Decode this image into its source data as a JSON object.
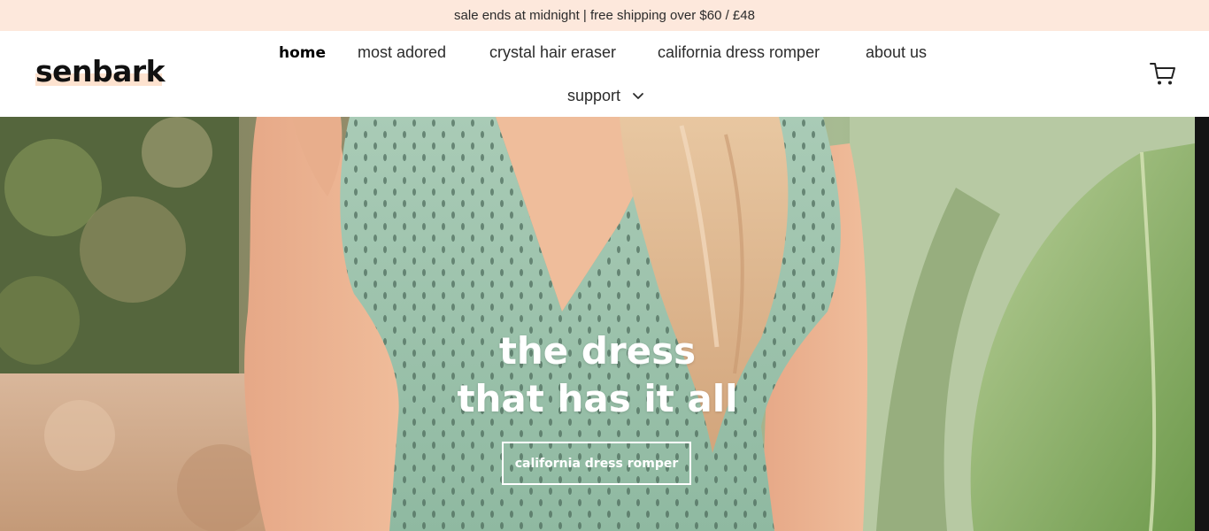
{
  "announcement": {
    "text": "sale ends at midnight | free shipping over $60 / £48"
  },
  "header": {
    "logo": "senbark",
    "nav": [
      {
        "label": "home",
        "active": true
      },
      {
        "label": "most adored"
      },
      {
        "label": "crystal hair eraser"
      },
      {
        "label": "california dress romper"
      },
      {
        "label": "about us"
      },
      {
        "label": "support",
        "has_dropdown": true
      }
    ],
    "cart_icon": "cart-icon"
  },
  "hero": {
    "title_line1": "the dress",
    "title_line2": "that has it all",
    "button_label": "california dress romper"
  },
  "colors": {
    "announcement_bg": "#fde8dc",
    "logo_highlight": "#fde2cf",
    "dress": "#9ec4ad",
    "hero_text": "#ffffff"
  }
}
